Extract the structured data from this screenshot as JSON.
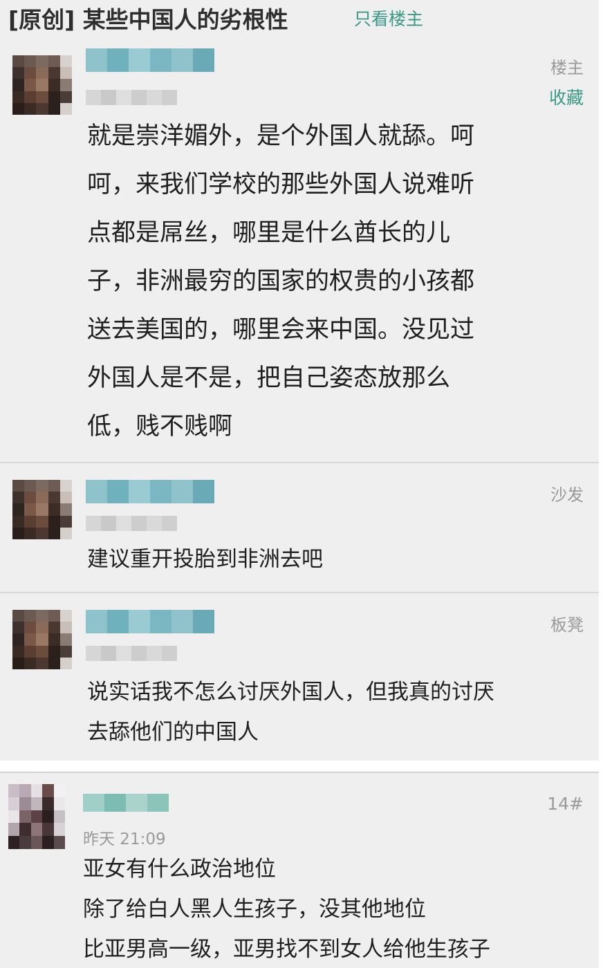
{
  "thread": {
    "title": "[原创] 某些中国人的劣根性",
    "only_op_label": "只看楼主"
  },
  "posts": [
    {
      "floor": "楼主",
      "action": "收藏",
      "body_lines": [
        "就是崇洋媚外，是个外国人就舔。呵",
        "呵，来我们学校的那些外国人说难听",
        "点都是屌丝，哪里是什么酋长的儿",
        "子，非洲最穷的国家的权贵的小孩都",
        "送去美国的，哪里会来中国。没见过",
        "外国人是不是，把自己姿态放那么",
        "低，贱不贱啊"
      ]
    },
    {
      "floor": "沙发",
      "body_lines": [
        "建议重开投胎到非洲去吧"
      ]
    },
    {
      "floor": "板凳",
      "body_lines": [
        "说实话我不怎么讨厌外国人，但我真的讨厌",
        "去舔他们的中国人"
      ]
    },
    {
      "floor": "14#",
      "time": "昨天 21:09",
      "body_lines": [
        "亚女有什么政治地位",
        "除了给白人黑人生孩子，没其他地位",
        "比亚男高一级，亚男找不到女人给他生孩子"
      ]
    }
  ],
  "icons": {
    "avatar": "pixelated-avatar-icon",
    "username": "blurred-username",
    "timestamp": "blurred-timestamp"
  },
  "colors": {
    "accent": "#3a9a87",
    "muted": "#9a9a9a",
    "post_bg": "#efefef",
    "text": "#1f1f1f"
  }
}
